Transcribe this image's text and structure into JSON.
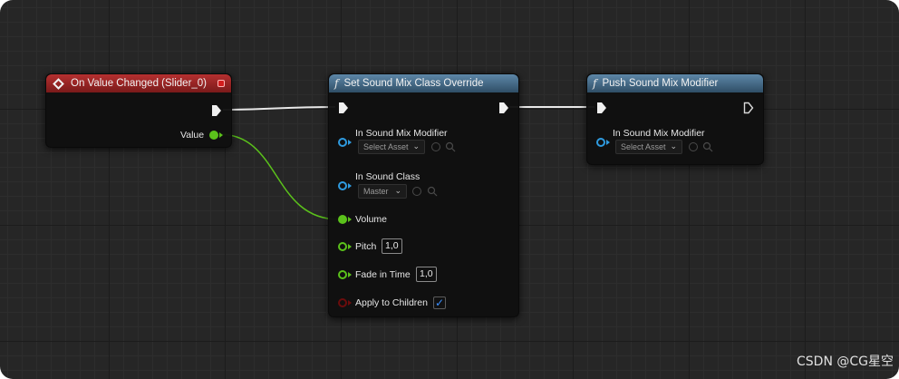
{
  "nodes": {
    "event": {
      "title": "On Value Changed (Slider_0)",
      "header_color": "#a82828",
      "pins": {
        "value_label": "Value"
      },
      "icon": "event-diamond-icon"
    },
    "set_override": {
      "title": "Set Sound Mix Class Override",
      "header_color": "#4a6f8f",
      "icon": "function-icon",
      "icon_glyph": "f",
      "pins": {
        "sound_mix_modifier_label": "In Sound Mix Modifier",
        "sound_mix_modifier_value": "Select Asset",
        "sound_class_label": "In Sound Class",
        "sound_class_value": "Master",
        "volume_label": "Volume",
        "pitch_label": "Pitch",
        "pitch_value": "1,0",
        "fade_label": "Fade in Time",
        "fade_value": "1,0",
        "apply_children_label": "Apply to Children",
        "apply_children_checked": true
      }
    },
    "push_modifier": {
      "title": "Push Sound Mix Modifier",
      "header_color": "#4a6f8f",
      "icon": "function-icon",
      "icon_glyph": "f",
      "pins": {
        "sound_mix_modifier_label": "In Sound Mix Modifier",
        "sound_mix_modifier_value": "Select Asset"
      }
    }
  },
  "colors": {
    "exec_wire": "#e8e8e8",
    "float_pin": "#5bc21b",
    "object_pin": "#2f9be0",
    "bool_pin": "#6b0c0c"
  },
  "watermark": "CSDN @CG星空"
}
